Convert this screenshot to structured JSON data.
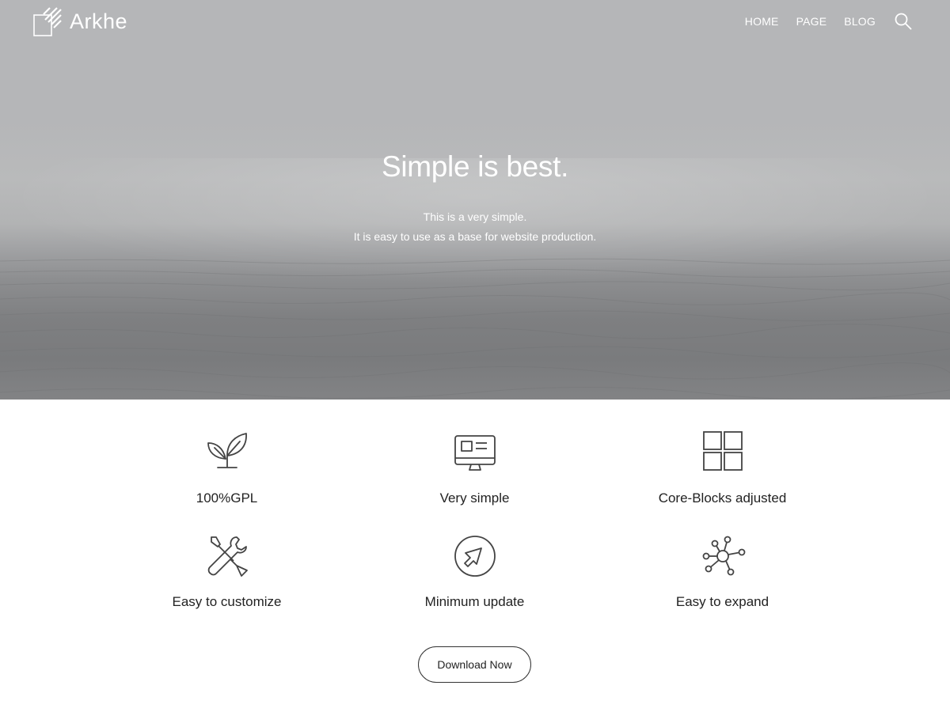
{
  "site": {
    "logo_text": "Arkhe",
    "nav": [
      {
        "label": "HOME"
      },
      {
        "label": "PAGE"
      },
      {
        "label": "BLOG"
      }
    ],
    "search_icon": "search-icon"
  },
  "hero": {
    "title": "Simple is best.",
    "subtitle_lines": [
      "This is a very simple.",
      "It is easy to use as a base for website production."
    ]
  },
  "features": [
    {
      "label": "100%GPL",
      "icon": "leaf-icon"
    },
    {
      "label": "Very simple",
      "icon": "monitor-icon"
    },
    {
      "label": "Core-Blocks adjusted",
      "icon": "grid-icon"
    },
    {
      "label": "Easy to customize",
      "icon": "tools-icon"
    },
    {
      "label": "Minimum update",
      "icon": "arrow-circle-icon"
    },
    {
      "label": "Easy to expand",
      "icon": "network-icon"
    }
  ],
  "cta": {
    "label": "Download Now"
  },
  "colors": {
    "hero_sky": "#b5b6b8",
    "hero_sea": "#7e7f81",
    "text": "#222222",
    "icon_stroke": "#444444"
  }
}
